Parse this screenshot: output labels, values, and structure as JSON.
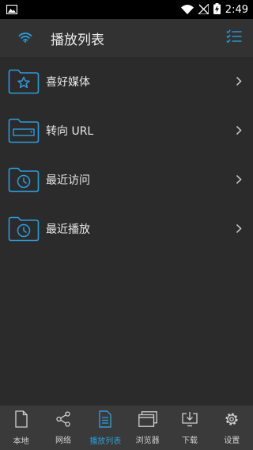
{
  "status_bar": {
    "time": "2:49"
  },
  "app_bar": {
    "title": "播放列表"
  },
  "list": {
    "items": [
      {
        "label": "喜好媒体",
        "icon": "folder-star-icon"
      },
      {
        "label": "转向 URL",
        "icon": "folder-url-icon"
      },
      {
        "label": "最近访问",
        "icon": "folder-clock-icon"
      },
      {
        "label": "最近播放",
        "icon": "folder-clock-icon"
      }
    ]
  },
  "bottom_nav": {
    "items": [
      {
        "label": "本地",
        "icon": "file-icon",
        "active": false
      },
      {
        "label": "网络",
        "icon": "share-icon",
        "active": false
      },
      {
        "label": "播放列表",
        "icon": "list-doc-icon",
        "active": true
      },
      {
        "label": "浏览器",
        "icon": "browser-icon",
        "active": false
      },
      {
        "label": "下载",
        "icon": "download-icon",
        "active": false
      },
      {
        "label": "设置",
        "icon": "gear-icon",
        "active": false
      }
    ]
  },
  "colors": {
    "accent": "#2f9bd8",
    "background": "#2b2b2b",
    "toolbar": "#323232",
    "bottom_nav": "#3a3a3a"
  }
}
